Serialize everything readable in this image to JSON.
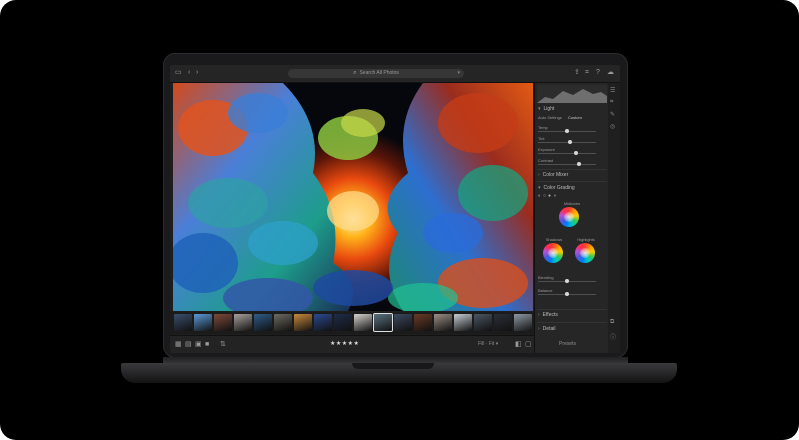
{
  "app": {
    "toolbar": {
      "search_placeholder": "Search All Photos",
      "search_icon": "magnifier-icon",
      "search_caret": "▾",
      "left_icons": [
        "sidebar-toggle-icon",
        "back-icon",
        "forward-icon"
      ],
      "right_icons": [
        "upload-icon",
        "crop-icon",
        "help-icon",
        "cloud-icon"
      ]
    },
    "panel": {
      "light_title": "Light",
      "profile_label": "Auto Settings",
      "profile_value": "Custom",
      "light_sliders": [
        {
          "label": "Temp",
          "value": 0.5
        },
        {
          "label": "Tint",
          "value": 0.55
        },
        {
          "label": "Exposure",
          "value": 0.65
        },
        {
          "label": "Contrast",
          "value": 0.7
        }
      ],
      "color_mixer_title": "Color Mixer",
      "color_grading_title": "Color Grading",
      "midtones_label": "Midtones",
      "shadows_label": "Shadows",
      "highlights_label": "Highlights",
      "grading_sliders": [
        {
          "label": "Blending",
          "value": 0.5
        },
        {
          "label": "Balance",
          "value": 0.5
        }
      ],
      "effects_title": "Effects",
      "detail_title": "Detail",
      "footer_label": "Presets"
    },
    "filmstrip": {
      "rating": "★★★★★",
      "rating_value": 5,
      "sort_label": "Fit",
      "zoom_label": "Fill · Fit ▾",
      "thumb_colors": [
        "#3a4f6e",
        "#5b9ad6",
        "#7b4b3a",
        "#a8a29e",
        "#2e5c8a",
        "#6e6a62",
        "#c98a3c",
        "#2b4a8f",
        "#1e2c49",
        "#d7d3cf",
        "#5a7280",
        "#3c4960",
        "#6b3a26",
        "#9b8f86",
        "#c8ced6",
        "#4b5563",
        "#2a2f38",
        "#8f9aa6"
      ],
      "selected_index": 10
    }
  }
}
